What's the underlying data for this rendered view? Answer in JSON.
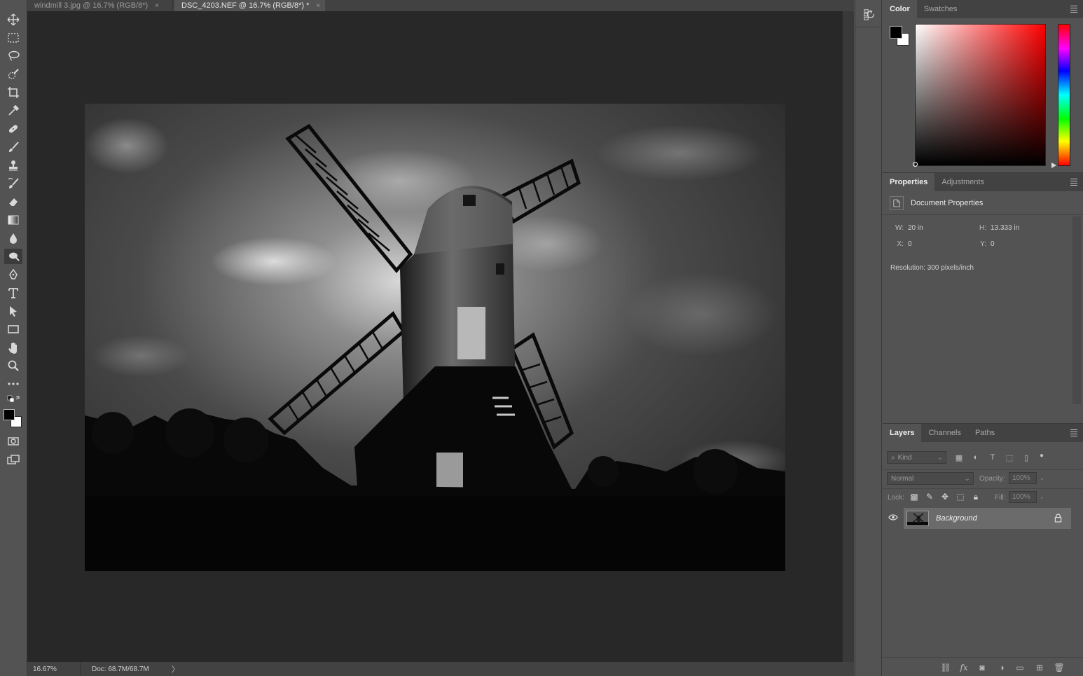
{
  "tabs": [
    {
      "label": "windmill 3.jpg @ 16.7% (RGB/8*)",
      "close": "×"
    },
    {
      "label": "DSC_4203.NEF @ 16.7% (RGB/8*) *",
      "close": "×"
    }
  ],
  "status": {
    "zoom": "16.67%",
    "doc": "Doc: 68.7M/68.7M",
    "arrow": "〉"
  },
  "color_panel": {
    "tabs": [
      "Color",
      "Swatches"
    ],
    "foreground": "#000000",
    "background": "#ffffff",
    "hue": "#ff0000"
  },
  "properties_panel": {
    "tabs": [
      "Properties",
      "Adjustments"
    ],
    "header": "Document Properties",
    "w_label": "W:",
    "w_value": "20 in",
    "h_label": "H:",
    "h_value": "13.333 in",
    "x_label": "X:",
    "x_value": "0",
    "y_label": "Y:",
    "y_value": "0",
    "resolution": "Resolution: 300 pixels/inch"
  },
  "layers_panel": {
    "tabs": [
      "Layers",
      "Channels",
      "Paths"
    ],
    "kind_label": "Kind",
    "blend_mode": "Normal",
    "opacity_label": "Opacity:",
    "opacity_value": "100%",
    "lock_label": "Lock:",
    "fill_label": "Fill:",
    "fill_value": "100%",
    "layers": [
      {
        "name": "Background",
        "visible": true,
        "locked": true
      }
    ]
  },
  "tools": [
    "move-tool",
    "marquee-tool",
    "lasso-tool",
    "quick-selection-tool",
    "crop-tool",
    "eyedropper-tool",
    "healing-brush-tool",
    "brush-tool",
    "clone-stamp-tool",
    "history-brush-tool",
    "eraser-tool",
    "gradient-tool",
    "blur-tool",
    "dodge-tool",
    "pen-tool",
    "type-tool",
    "path-selection-tool",
    "rectangle-tool",
    "hand-tool",
    "zoom-tool",
    "more-tools"
  ],
  "accent": {
    "panel_bg": "#535353",
    "canvas_bg": "#282828",
    "tab_bg": "#424242"
  }
}
